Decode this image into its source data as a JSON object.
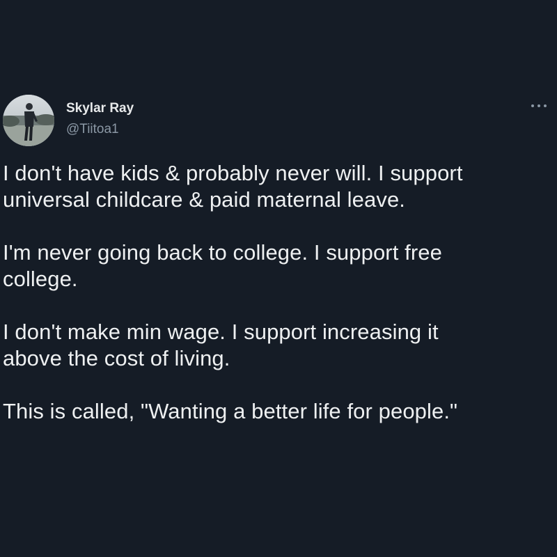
{
  "author": {
    "display_name": "Skylar Ray",
    "handle": "@Tiitoa1",
    "avatar_icon": "user-photo-avatar"
  },
  "menu": {
    "icon": "more-horizontal-icon",
    "label": "···"
  },
  "tweet": {
    "paragraphs": [
      "I don't have kids & probably never will. I support\nuniversal childcare & paid maternal leave.",
      "I'm never going back to college. I support free\ncollege.",
      "I don't make min wage. I support increasing it\nabove the cost of living.",
      "This is called, \"Wanting a better life for people.\""
    ]
  },
  "colors": {
    "background": "#151c26",
    "text": "#e7e9ea",
    "secondary_text": "#8b98a5"
  }
}
